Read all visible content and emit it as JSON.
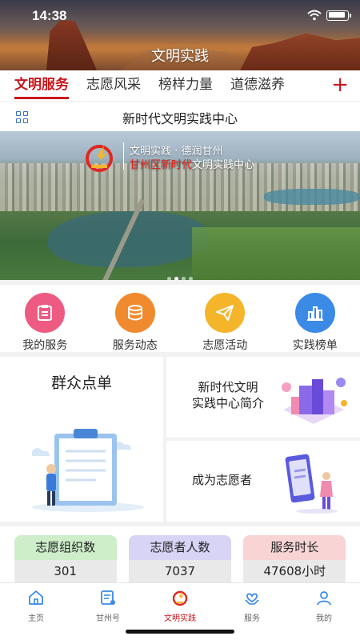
{
  "status_bar": {
    "time": "14:38"
  },
  "header": {
    "title": "文明实践"
  },
  "tabs": [
    {
      "label": "文明服务",
      "active": true
    },
    {
      "label": "志愿风采",
      "active": false
    },
    {
      "label": "榜样力量",
      "active": false
    },
    {
      "label": "道德滋养",
      "active": false
    }
  ],
  "tab_add_symbol": "+",
  "subheader": {
    "title": "新时代文明实践中心"
  },
  "banner": {
    "line1": "文明实践 · 德润甘州",
    "line2_red": "甘州区新时代",
    "line2_white": "文明实践中心",
    "dot_count": 4,
    "active_dot": 1
  },
  "quick_items": [
    {
      "label": "我的服务",
      "icon": "clipboard-icon",
      "color": "#ee5b82"
    },
    {
      "label": "服务动态",
      "icon": "coins-icon",
      "color": "#f08a2e"
    },
    {
      "label": "志愿活动",
      "icon": "paper-plane-icon",
      "color": "#f5b52a"
    },
    {
      "label": "实践榜单",
      "icon": "bar-chart-icon",
      "color": "#3a8ae6"
    }
  ],
  "cards": {
    "left_title": "群众点单",
    "right_top_line1": "新时代文明",
    "right_top_line2": "实践中心简介",
    "right_bottom": "成为志愿者"
  },
  "stats": [
    {
      "label": "志愿组织数",
      "value": "301",
      "color": "#cdeec9"
    },
    {
      "label": "志愿者人数",
      "value": "7037",
      "color": "#d8d4f6"
    },
    {
      "label": "服务时长",
      "value": "47608小时",
      "color": "#f8d4d4"
    }
  ],
  "bottom_nav": [
    {
      "label": "主页",
      "icon": "home-icon",
      "active": false
    },
    {
      "label": "甘州号",
      "icon": "news-icon",
      "active": false
    },
    {
      "label": "文明实践",
      "icon": "emblem-icon",
      "active": true
    },
    {
      "label": "服务",
      "icon": "heart-hands-icon",
      "active": false
    },
    {
      "label": "我的",
      "icon": "user-icon",
      "active": false
    }
  ],
  "accent_color": "#c8161d"
}
